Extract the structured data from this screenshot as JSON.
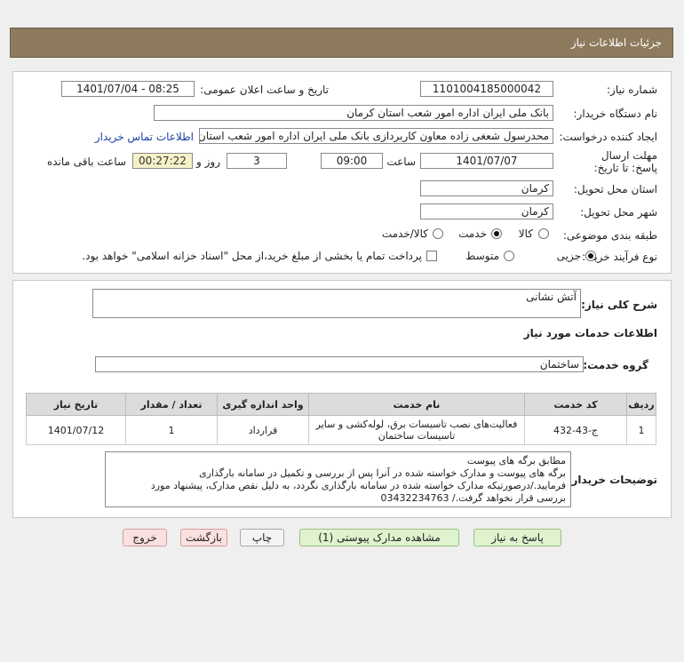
{
  "header": {
    "title": "جزئیات اطلاعات نیاز"
  },
  "form": {
    "need_number_label": "شماره نیاز:",
    "need_number": "1101004185000042",
    "announce_label": "تاریخ و ساعت اعلان عمومی:",
    "announce_value": "1401/07/04 - 08:25",
    "buyer_org_label": "نام دستگاه خریدار:",
    "buyer_org": "بانک ملی ایران اداره امور شعب استان کرمان",
    "creator_label": "ایجاد کننده درخواست:",
    "creator": "محدرسول شعغی زاده معاون کاربردازی بانک ملی ایران اداره امور شعب استان کرمان",
    "contact_link": "اطلاعات تماس خریدار",
    "deadline_label": "مهلت ارسال پاسخ: تا تاریخ:",
    "deadline_date": "1401/07/07",
    "time_label": "ساعت",
    "deadline_time": "09:00",
    "days_value": "3",
    "days_label": "روز و",
    "remaining_time": "00:27:22",
    "remaining_label": "ساعت باقی مانده",
    "province_label": "استان محل تحویل:",
    "province": "کرمان",
    "city_label": "شهر محل تحویل:",
    "city": "کرمان",
    "category_label": "طبقه بندی موضوعی:",
    "category_options": [
      "کالا",
      "خدمت",
      "کالا/خدمت"
    ],
    "category_selected": "خدمت",
    "process_label": "نوع فرآیند خرید :",
    "process_options": [
      "جزیی",
      "متوسط"
    ],
    "process_selected": "جزیی",
    "payment_note": "پرداخت تمام یا بخشی از مبلغ خرید،از محل \"اسناد خزانه اسلامی\" خواهد بود."
  },
  "details": {
    "summary_label": "شرح کلی نیاز:",
    "summary": "آتش نشانی",
    "services_title": "اطلاعات خدمات مورد نیاز",
    "service_group_label": "گروه خدمت:",
    "service_group": "ساختمان",
    "table": {
      "headers": [
        "ردیف",
        "کد خدمت",
        "نام خدمت",
        "واحد اندازه گیری",
        "تعداد / مقدار",
        "تاریخ نیاز"
      ],
      "rows": [
        {
          "row": "1",
          "code": "ج-43-432",
          "name": "فعالیت‌های نصب تاسیسات برق، لوله‌کشی و سایر تاسیسات ساختمان",
          "unit": "قرارداد",
          "qty": "1",
          "date": "1401/07/12"
        }
      ]
    },
    "buyer_notes_label": "توضیحات خریدار:",
    "buyer_notes": [
      "مطابق برگه های پیوست",
      "برگه های پیوست و مدارک خواسته شده در آنرا پس از بررسی و تکمیل در سامانه بارگذاری",
      "فرمایید./درصورتیکه مدارک خواسته شده در سامانه بارگذاری نگردد، به دلیل نقص مدارک، پیشنهاد مورد",
      "بررسی قرار نخواهد گرفت./ 03432234763"
    ]
  },
  "buttons": {
    "reply": "پاسخ به نیاز",
    "view_docs": "مشاهده مدارک پیوستی (1)",
    "print": "چاپ",
    "back": "بازگشت",
    "exit": "خروج"
  },
  "colors": {
    "header_bg": "#8e7b5e",
    "remaining_bg": "#f6f1c8"
  }
}
